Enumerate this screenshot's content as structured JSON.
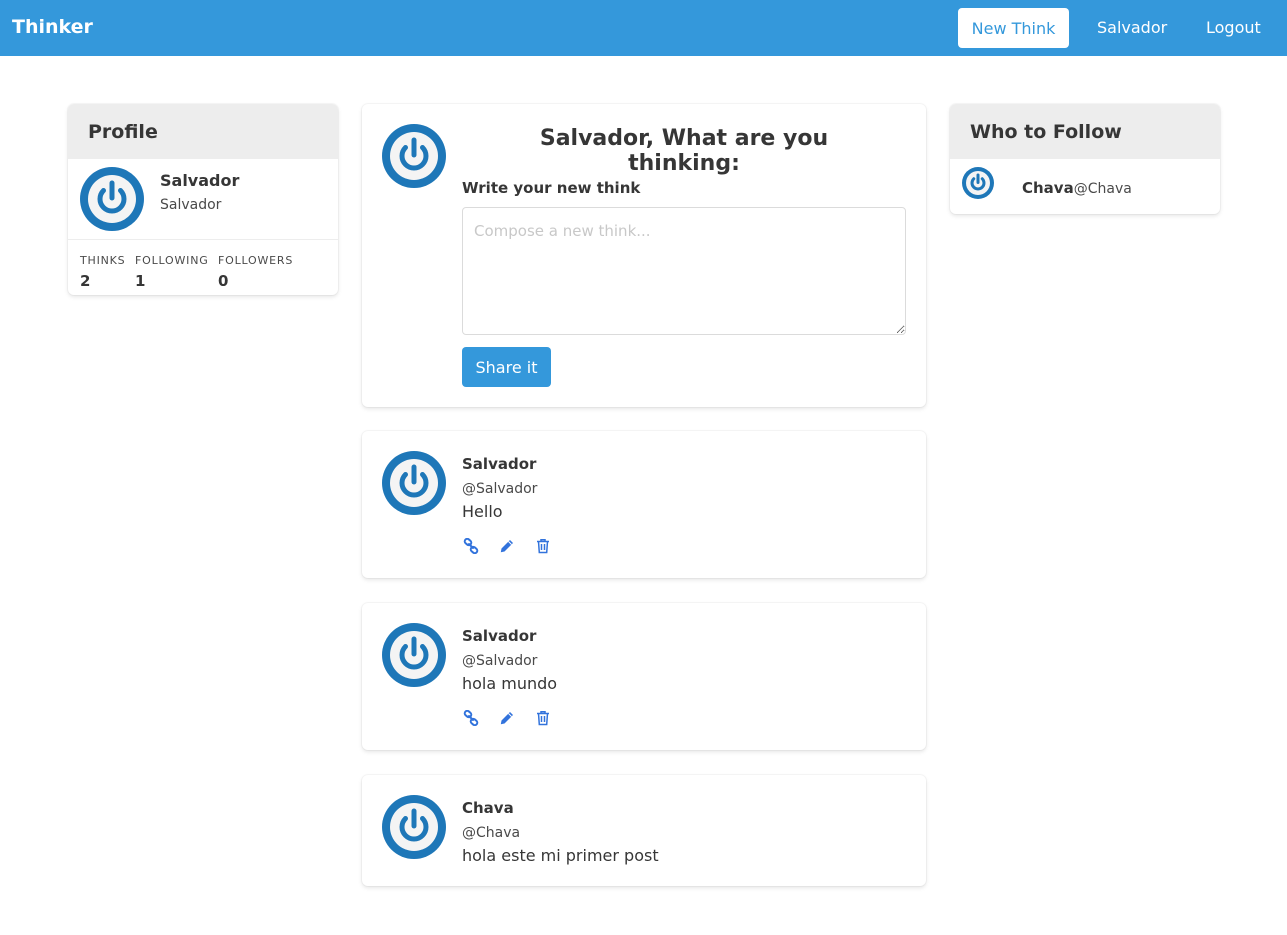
{
  "navbar": {
    "brand": "Thinker",
    "new_think": "New Think",
    "user": "Salvador",
    "logout": "Logout"
  },
  "profile": {
    "title": "Profile",
    "name": "Salvador",
    "username": "Salvador",
    "stats": [
      {
        "label": "THINKS",
        "value": "2"
      },
      {
        "label": "FOLLOWING",
        "value": "1"
      },
      {
        "label": "FOLLOWERS",
        "value": "0"
      }
    ]
  },
  "compose": {
    "title": "Salvador, What are you thinking:",
    "label": "Write your new think",
    "placeholder": "Compose a new think...",
    "value": "",
    "submit": "Share it"
  },
  "posts": [
    {
      "name": "Salvador",
      "handle": "@Salvador",
      "text": "Hello",
      "actions": [
        "link-icon",
        "pencil-icon",
        "trash-icon"
      ]
    },
    {
      "name": "Salvador",
      "handle": "@Salvador",
      "text": "hola mundo",
      "actions": [
        "link-icon",
        "pencil-icon",
        "trash-icon"
      ]
    },
    {
      "name": "Chava",
      "handle": "@Chava",
      "text": "hola este mi primer post",
      "actions": []
    }
  ],
  "who_to_follow": {
    "title": "Who to Follow",
    "users": [
      {
        "name": "Chava",
        "handle": "@Chava"
      }
    ]
  },
  "colors": {
    "primary": "#3498db",
    "avatar": "#1e77b8",
    "action_icon": "#3273dc",
    "panel_header": "#ededed"
  },
  "icons": {
    "avatar": "power-icon"
  }
}
